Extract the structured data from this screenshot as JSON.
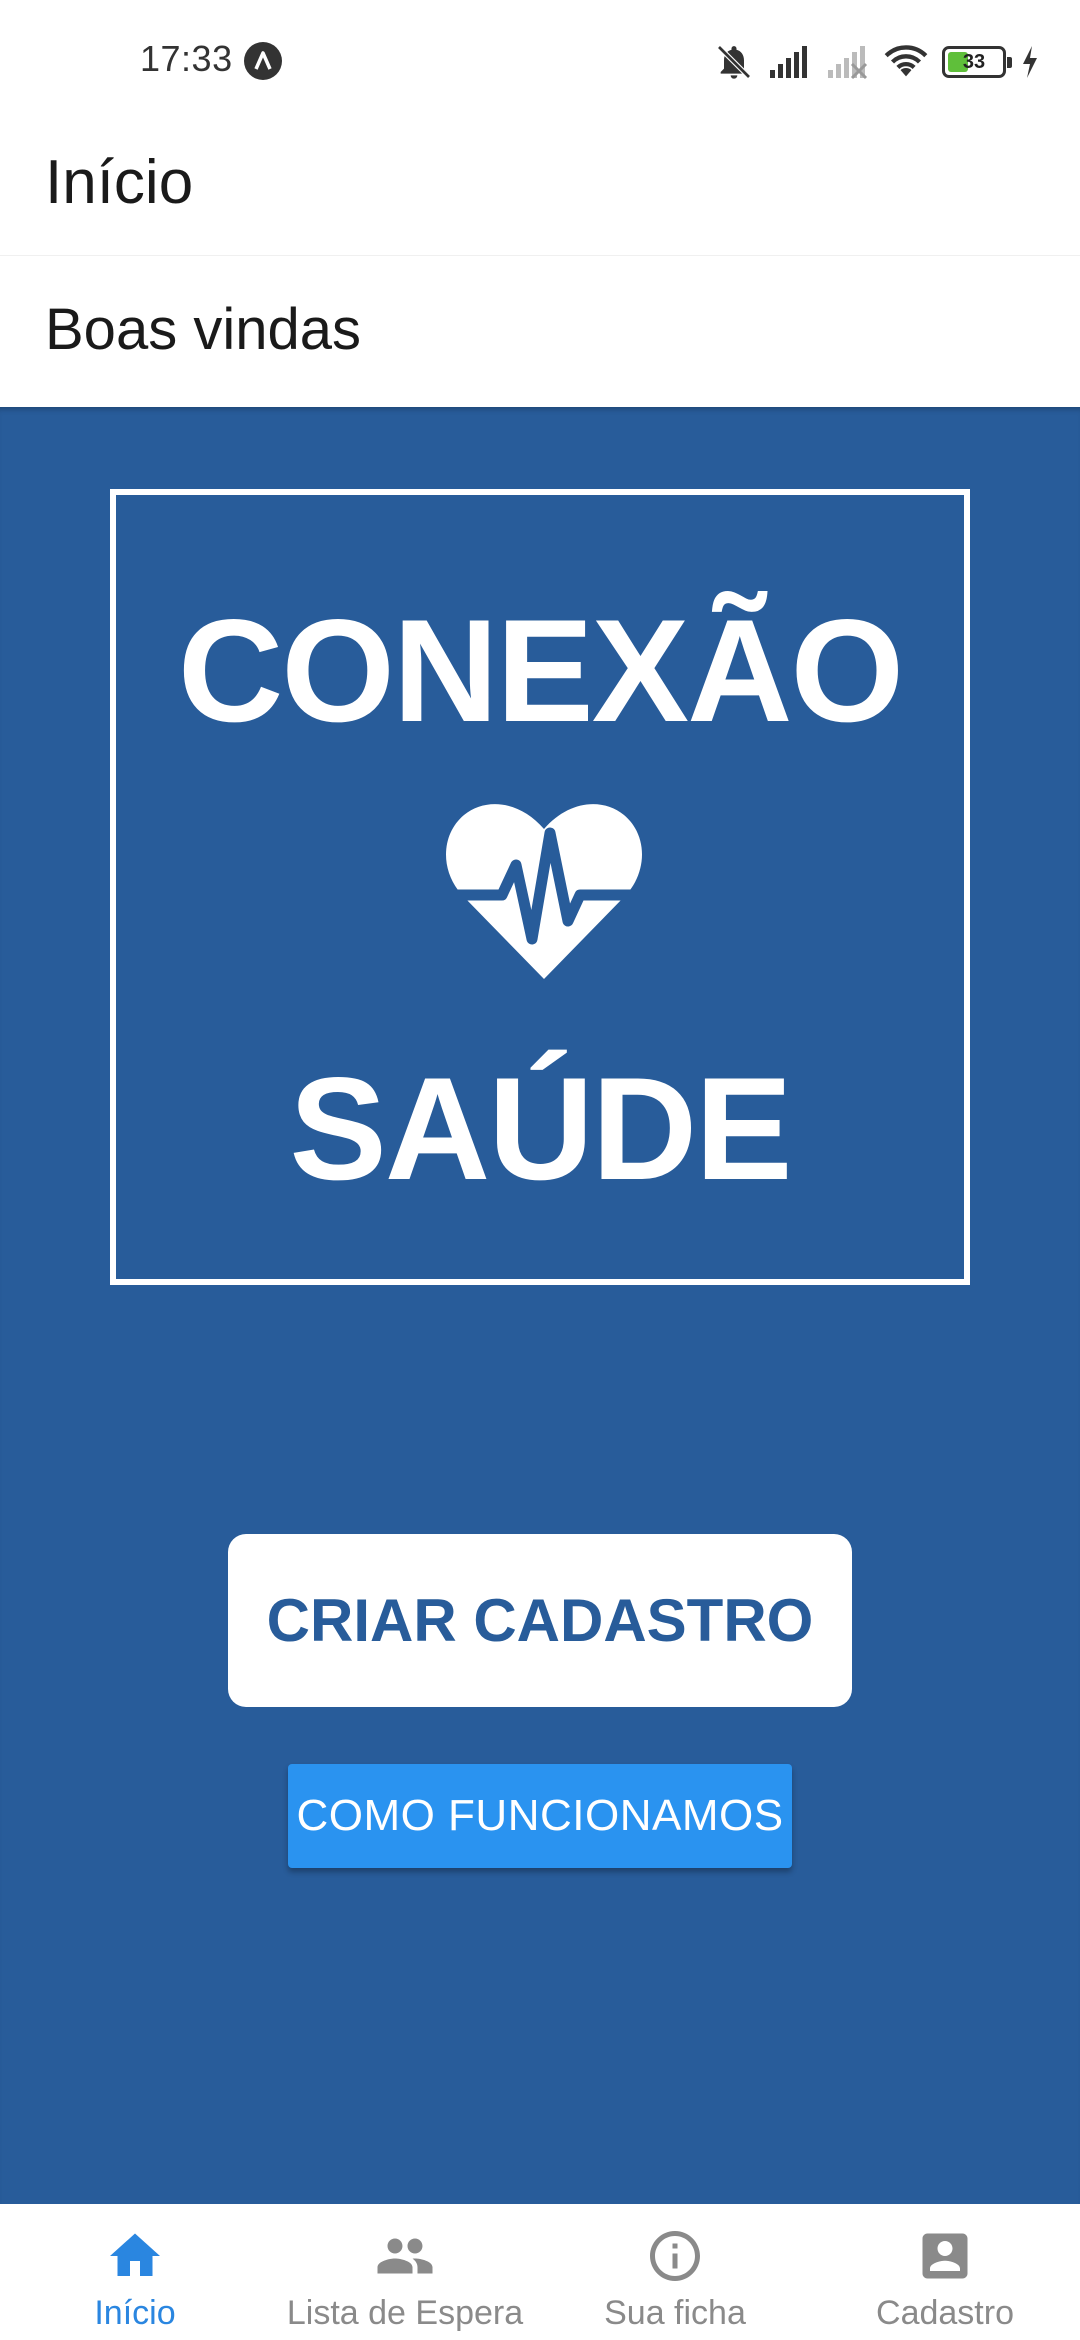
{
  "status_bar": {
    "time": "17:33",
    "battery_level": "33",
    "icons": [
      "app-notification-icon",
      "bell-off-icon",
      "signal-icon",
      "signal-empty-icon",
      "wifi-icon",
      "battery-icon",
      "charging-icon"
    ]
  },
  "header": {
    "title": "Início"
  },
  "sub_header": {
    "title": "Boas vindas"
  },
  "logo": {
    "line1": "CONEXÃO",
    "line2": "SAÚDE",
    "icon": "heart-pulse-icon"
  },
  "actions": {
    "primary_label": "CRIAR CADASTRO",
    "secondary_label": "COMO FUNCIONAMOS"
  },
  "bottom_nav": {
    "items": [
      {
        "label": "Início",
        "icon": "home-icon",
        "active": true
      },
      {
        "label": "Lista de Espera",
        "icon": "people-icon",
        "active": false
      },
      {
        "label": "Sua ficha",
        "icon": "info-icon",
        "active": false
      },
      {
        "label": "Cadastro",
        "icon": "account-box-icon",
        "active": false
      }
    ]
  },
  "colors": {
    "primary_blue": "#285c9a",
    "button_blue": "#2a93f0",
    "active_nav": "#2a86e0",
    "inactive_nav": "#8a8a8a",
    "white": "#ffffff"
  }
}
